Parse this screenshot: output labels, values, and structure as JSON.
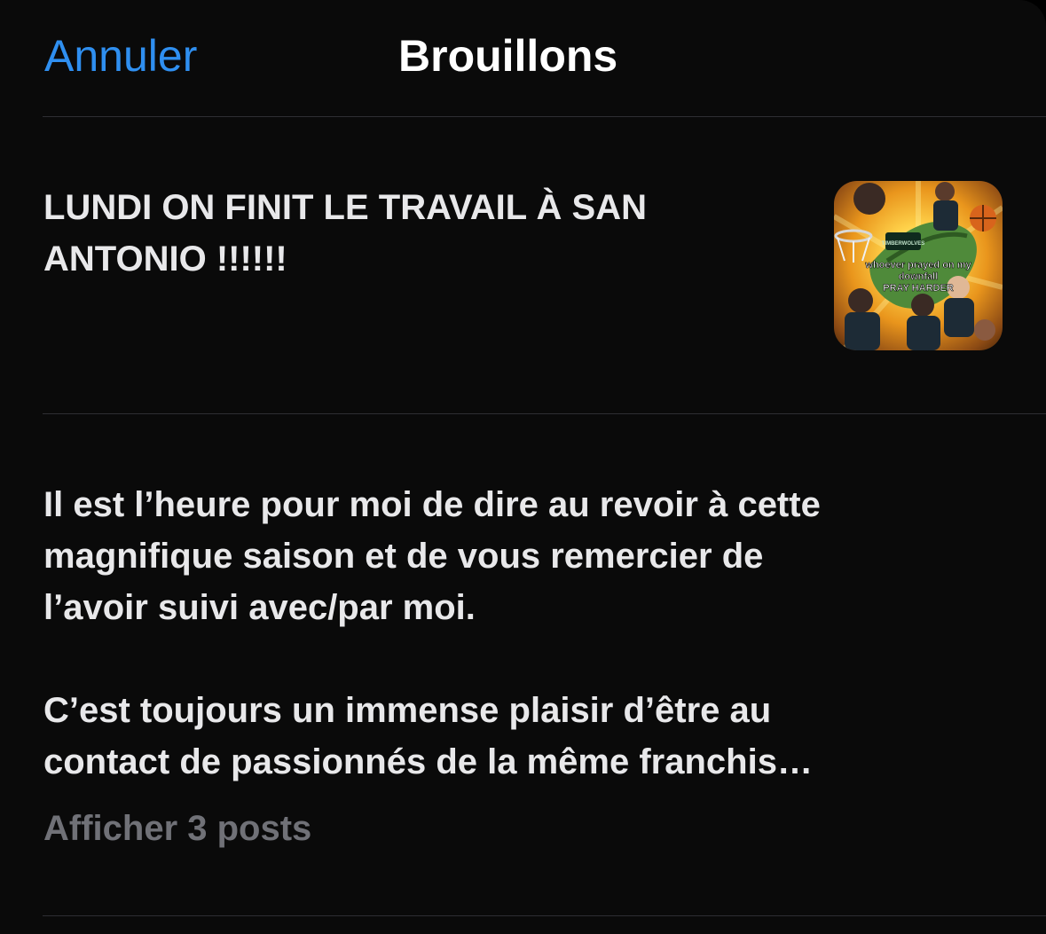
{
  "header": {
    "cancel_label": "Annuler",
    "title": "Brouillons"
  },
  "drafts": [
    {
      "text": "LUNDI ON FINIT LE TRAVAIL À SAN\nANTONIO !!!!!!",
      "thumbnail": {
        "logo_text": "TIMBERWOLVES",
        "caption_line1": "whoever prayed on my",
        "caption_line2": "downfall",
        "caption_line3": "PRAY HARDER"
      }
    },
    {
      "text": "Il est l’heure pour moi de dire au revoir à cette\nmagnifique saison et de vous remercier de\nl’avoir suivi avec/par moi.\n\nC’est toujours un immense plaisir d’être au\ncontact de passionnés de la même franchis…",
      "show_more_label": "Afficher 3 posts"
    }
  ],
  "colors": {
    "accent": "#2f8ff0",
    "background": "#0a0a0a",
    "text": "#e8e8ea",
    "muted": "#707177",
    "divider": "#2e2e33"
  }
}
